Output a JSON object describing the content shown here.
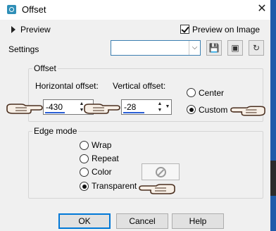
{
  "window": {
    "title": "Offset",
    "close_glyph": "✕"
  },
  "preview": {
    "label": "Preview",
    "preview_on_image_label": "Preview on Image",
    "preview_on_image_checked": true
  },
  "settings": {
    "label": "Settings",
    "preset_value": ""
  },
  "offset": {
    "group_label": "Offset",
    "horizontal_label": "Horizontal offset:",
    "horizontal_value": "-430",
    "vertical_label": "Vertical offset:",
    "vertical_value": "-28",
    "center_label": "Center",
    "custom_label": "Custom",
    "selected": "Custom"
  },
  "edge_mode": {
    "group_label": "Edge mode",
    "options": [
      "Wrap",
      "Repeat",
      "Color",
      "Transparent"
    ],
    "selected": "Transparent"
  },
  "buttons": {
    "ok": "OK",
    "cancel": "Cancel",
    "help": "Help"
  },
  "icons": {
    "title": "offset-app-icon",
    "toolbar": [
      "save-preset-icon",
      "random-icon",
      "reset-icon"
    ],
    "color_swatch": "no-color-icon",
    "pointer": "pointing-hand-icon"
  },
  "colors": {
    "accent": "#0078d7",
    "title_icon": "#2f8fb7",
    "sidebar": "#1e5baa"
  }
}
